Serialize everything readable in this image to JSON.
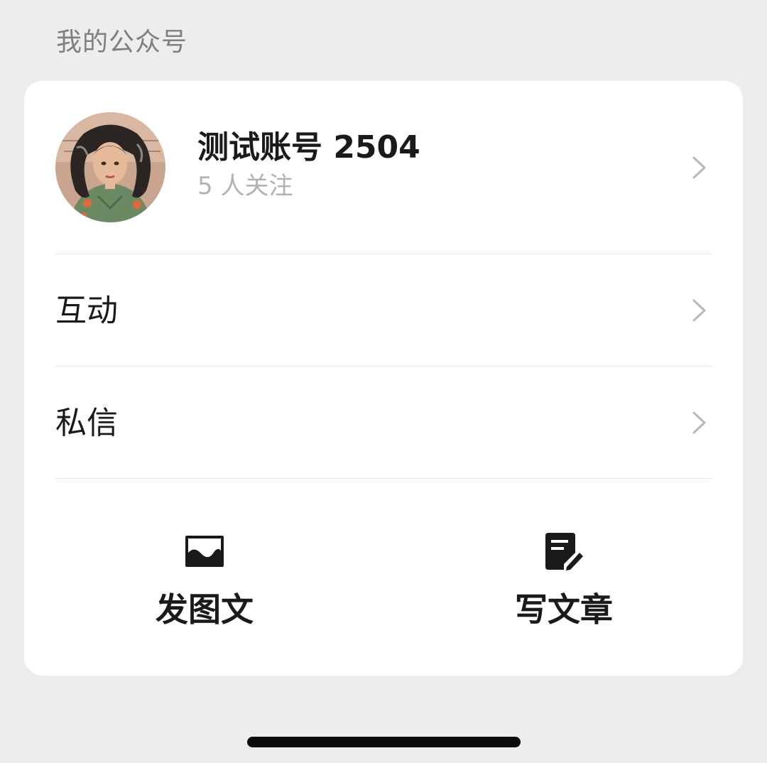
{
  "section": {
    "title": "我的公众号"
  },
  "account": {
    "name": "测试账号 2504",
    "followers": "5 人关注",
    "avatar_icon": "portrait-illustration"
  },
  "menu": {
    "items": [
      {
        "label": "互动",
        "icon": "chevron-right-icon"
      },
      {
        "label": "私信",
        "icon": "chevron-right-icon"
      }
    ]
  },
  "actions": [
    {
      "label": "发图文",
      "icon": "image-icon"
    },
    {
      "label": "写文章",
      "icon": "edit-document-icon"
    }
  ],
  "colors": {
    "background": "#ededed",
    "card": "#ffffff",
    "primary_text": "#1a1a1a",
    "secondary_text": "#b2b2b2",
    "header_text": "#7f7f7f",
    "divider": "#e5e5e5",
    "chevron": "#b8b8b8"
  }
}
